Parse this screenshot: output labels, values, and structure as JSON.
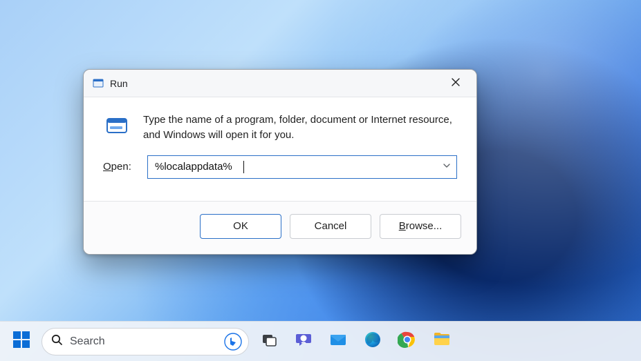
{
  "dialog": {
    "title": "Run",
    "description": "Type the name of a program, folder, document or Internet resource, and Windows will open it for you.",
    "open_label_prefix": "O",
    "open_label_rest": "pen:",
    "input_value": "%localappdata%",
    "ok_label": "OK",
    "cancel_label": "Cancel",
    "browse_label_prefix": "B",
    "browse_label_rest": "rowse..."
  },
  "taskbar": {
    "search_placeholder": "Search"
  }
}
